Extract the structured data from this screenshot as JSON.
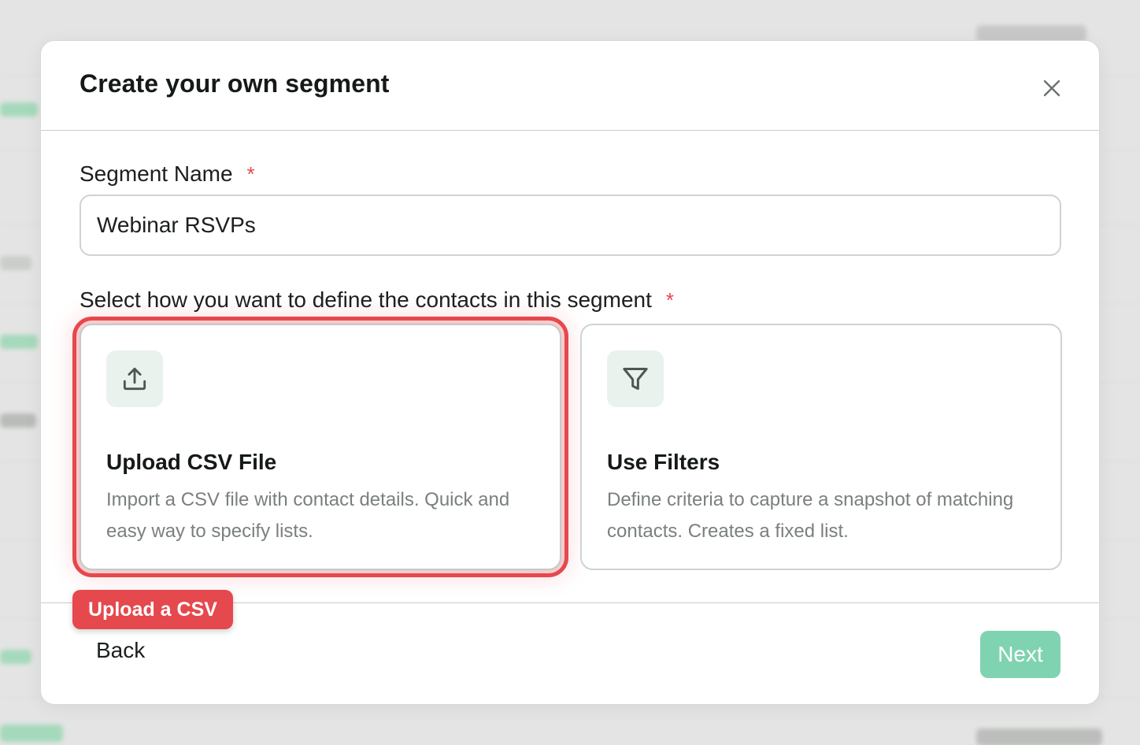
{
  "modal": {
    "title": "Create your own segment",
    "close_icon": "close-icon"
  },
  "segment_name": {
    "label": "Segment Name",
    "required_mark": "*",
    "value": "Webinar RSVPs"
  },
  "define_contacts": {
    "label": "Select how you want to define the contacts in this segment",
    "required_mark": "*",
    "options": [
      {
        "icon": "upload-icon",
        "title": "Upload CSV File",
        "description": "Import a CSV file with contact details. Quick and easy way to specify lists."
      },
      {
        "icon": "filter-icon",
        "title": "Use Filters",
        "description": "Define criteria to capture a snapshot of matching contacts. Creates a fixed list."
      }
    ]
  },
  "footer": {
    "back_label": "Back",
    "next_label": "Next"
  },
  "annotation": {
    "callout_label": "Upload a CSV"
  },
  "colors": {
    "accent_required": "#e5484d",
    "next_button": "#7fd3b1",
    "icon_tile": "#eaf2ee",
    "callout": "#e5484d"
  }
}
